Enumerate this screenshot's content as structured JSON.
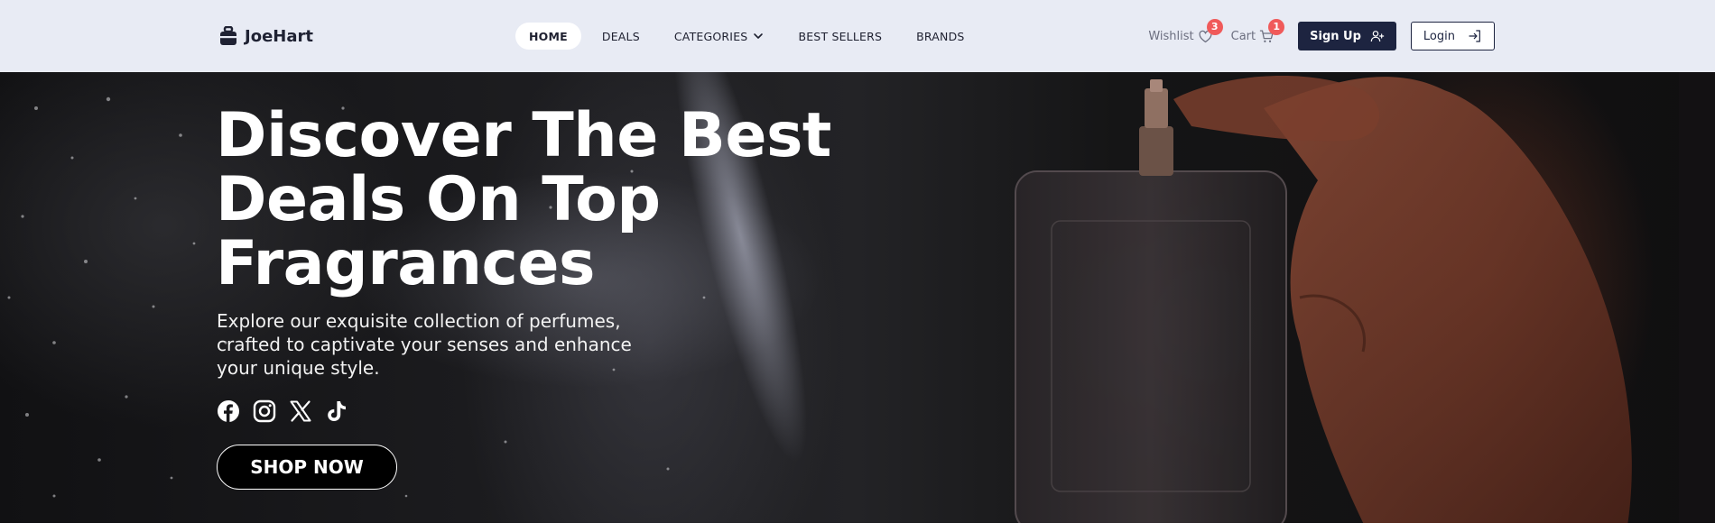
{
  "brand": {
    "name": "JoeHart",
    "icon": "shopping-bag-icon"
  },
  "nav": {
    "items": [
      {
        "label": "HOME",
        "active": true
      },
      {
        "label": "DEALS"
      },
      {
        "label": "CATEGORIES",
        "icon": "chevron-down-icon"
      },
      {
        "label": "BEST SELLERS"
      },
      {
        "label": "BRANDS"
      }
    ]
  },
  "actions": {
    "wishlist": {
      "label": "Wishlist",
      "count": "3",
      "icon": "heart-icon"
    },
    "cart": {
      "label": "Cart",
      "count": "1",
      "icon": "cart-icon"
    },
    "signup": {
      "label": "Sign Up",
      "icon": "user-plus-icon"
    },
    "login": {
      "label": "Login",
      "icon": "login-arrow-icon"
    }
  },
  "hero": {
    "title_lines": [
      "Discover The Best",
      "Deals On Top",
      "Fragrances"
    ],
    "subtitle_lines": [
      "Explore our exquisite collection of perfumes,",
      "crafted to captivate your senses and enhance",
      "your unique style."
    ],
    "socials": [
      "facebook-icon",
      "instagram-icon",
      "x-icon",
      "tiktok-icon"
    ],
    "cta": "SHOP NOW"
  },
  "colors": {
    "header_bg": "#e8ebf4",
    "primary": "#1d2440",
    "badge": "#f05a5a",
    "hero_text": "#ffffff"
  }
}
